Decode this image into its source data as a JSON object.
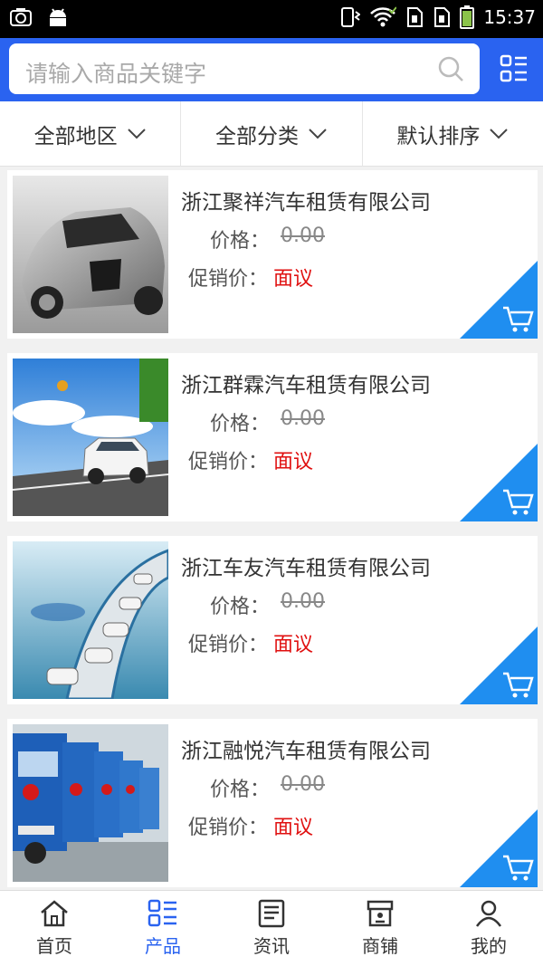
{
  "status_bar": {
    "time": "15:37"
  },
  "search": {
    "placeholder": "请输入商品关键字"
  },
  "filters": [
    {
      "label": "全部地区"
    },
    {
      "label": "全部分类"
    },
    {
      "label": "默认排序"
    }
  ],
  "products": [
    {
      "title": "浙江聚祥汽车租赁有限公司",
      "price_label": "价格：",
      "price": "0.00",
      "promo_label": "促销价：",
      "promo": "面议",
      "image": "silver-concept-car"
    },
    {
      "title": "浙江群霖汽车租赁有限公司",
      "price_label": "价格：",
      "price": "0.00",
      "promo_label": "促销价：",
      "promo": "面议",
      "image": "white-suv-road"
    },
    {
      "title": "浙江车友汽车租赁有限公司",
      "price_label": "价格：",
      "price": "0.00",
      "promo_label": "促销价：",
      "promo": "面议",
      "image": "cars-on-bridge"
    },
    {
      "title": "浙江融悦汽车租赁有限公司",
      "price_label": "价格：",
      "price": "0.00",
      "promo_label": "促销价：",
      "promo": "面议",
      "image": "blue-trucks-row"
    }
  ],
  "tabs": [
    {
      "label": "首页",
      "icon": "home-icon"
    },
    {
      "label": "产品",
      "icon": "list-icon"
    },
    {
      "label": "资讯",
      "icon": "news-icon"
    },
    {
      "label": "商铺",
      "icon": "shop-icon"
    },
    {
      "label": "我的",
      "icon": "user-icon"
    }
  ],
  "colors": {
    "accent": "#2a63f0",
    "promo": "#e01010"
  }
}
